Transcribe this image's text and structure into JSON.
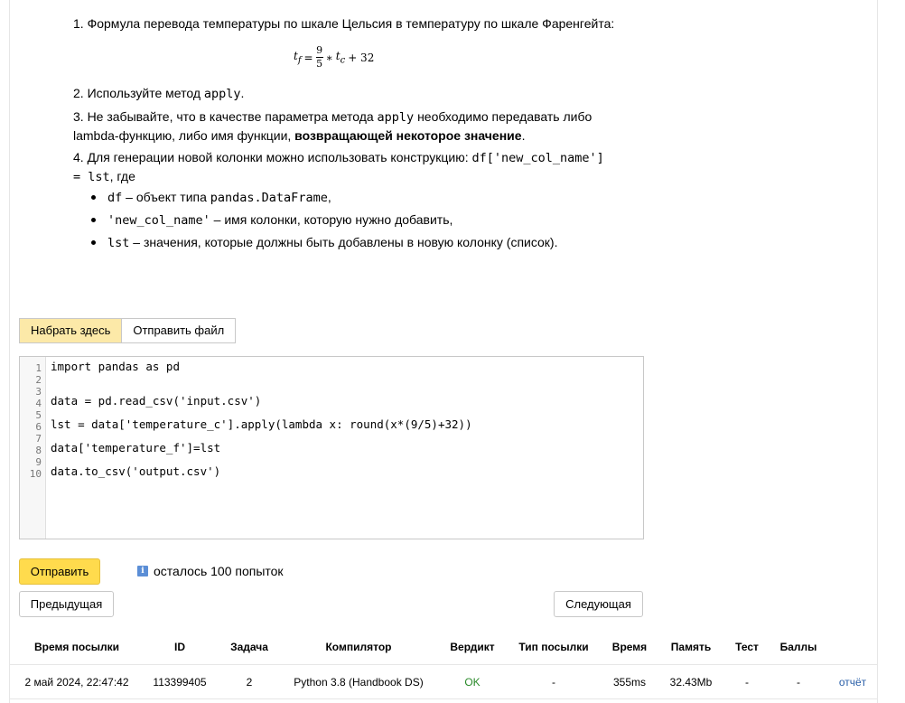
{
  "statement": {
    "item1": "1. Формула перевода температуры по шкале Цельсия в температуру по шкале Фаренгейта:",
    "formula": {
      "lhs": "t",
      "lhs_sub": "f",
      "eq": "=",
      "num": "9",
      "den": "5",
      "times": "∗",
      "var": "t",
      "var_sub": "c",
      "plus": "+ 32"
    },
    "item2_prefix": "2. Используйте метод ",
    "item2_code": "apply",
    "item2_suffix": ".",
    "item3_prefix": "3. Не забывайте, что в качестве параметра метода ",
    "item3_code": "apply",
    "item3_middle": " необходимо передавать либо lambda-функцию, либо имя функции, ",
    "item3_bold": "возвращающей некоторое значение",
    "item3_suffix": ".",
    "item4_prefix": "4. Для генерации новой колонки можно использовать конструкцию: ",
    "item4_code": "df['new_col_name'] = lst",
    "item4_suffix": ", где",
    "bullets": [
      {
        "code": "df",
        "text": " – объект типа ",
        "code2": "pandas.DataFrame",
        "tail": ","
      },
      {
        "code": "'new_col_name'",
        "text": " – имя колонки, которую нужно добавить,",
        "code2": "",
        "tail": ""
      },
      {
        "code": "lst",
        "text": " – значения, которые должны быть добавлены в новую колонку (список).",
        "code2": "",
        "tail": ""
      }
    ]
  },
  "tabs": [
    "Набрать здесь",
    "Отправить файл"
  ],
  "editor": {
    "lines": [
      "import pandas as pd",
      "",
      "",
      "data = pd.read_csv('input.csv')",
      "",
      "lst = data['temperature_c'].apply(lambda x: round(x*(9/5)+32))",
      "",
      "data['temperature_f']=lst",
      "",
      "data.to_csv('output.csv')"
    ]
  },
  "actions": {
    "submit": "Отправить",
    "attempts": "осталось 100 попыток",
    "info_icon": "i",
    "prev": "Предыдущая",
    "next": "Следующая"
  },
  "table": {
    "headers": [
      "Время посылки",
      "ID",
      "Задача",
      "Компилятор",
      "Вердикт",
      "Тип посылки",
      "Время",
      "Память",
      "Тест",
      "Баллы",
      ""
    ],
    "rows": [
      [
        "2 май 2024, 22:47:42",
        "113399405",
        "2",
        "Python 3.8 (Handbook DS)",
        "OK",
        "-",
        "355ms",
        "32.43Mb",
        "-",
        "-",
        "отчёт"
      ]
    ]
  },
  "colors": {
    "accent_yellow": "#ffdb4d",
    "active_tab": "#fce9a8",
    "ok_green": "#2a8a2a",
    "link_blue": "#2a5fa8"
  }
}
